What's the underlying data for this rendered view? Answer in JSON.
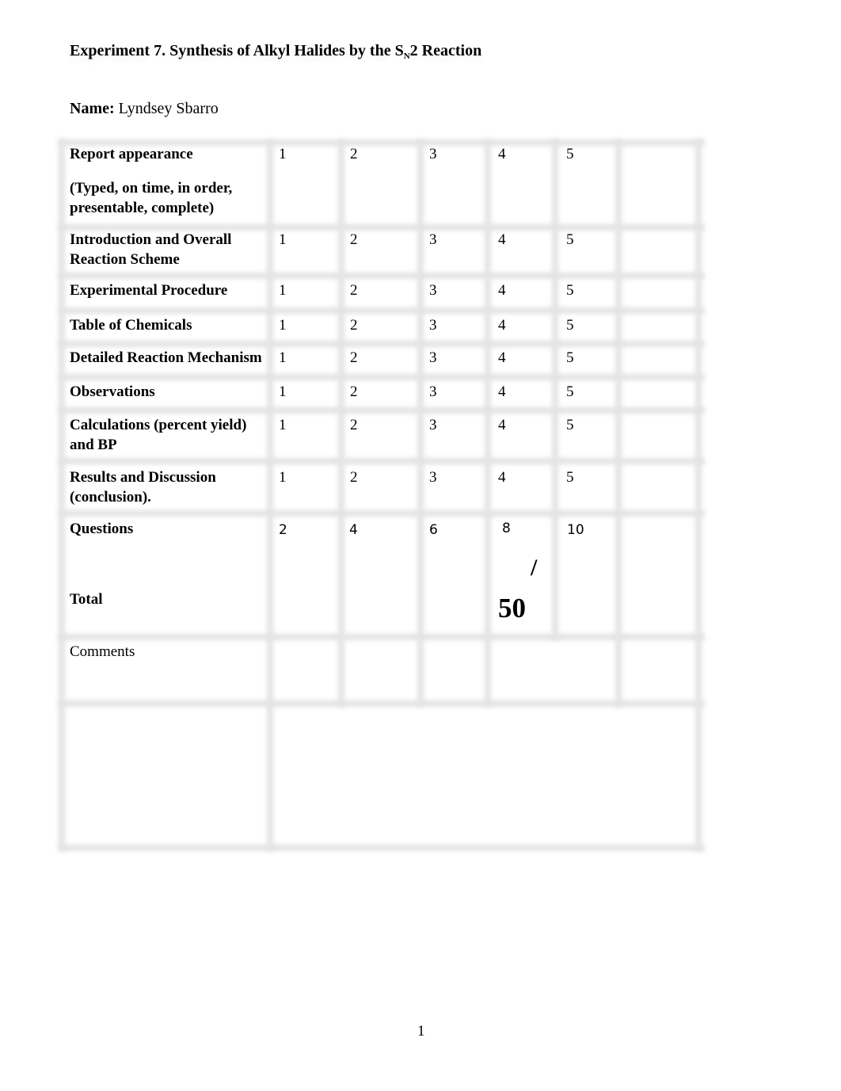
{
  "document": {
    "title_prefix": "Experiment 7.  Synthesis of Alkyl Halides by the S",
    "title_sub": "N",
    "title_suffix": "2 Reaction",
    "name_label": "Name:",
    "name_value": " Lyndsey Sbarro",
    "page_number": "1"
  },
  "rubric": {
    "rows": [
      {
        "label": "Report appearance",
        "scores": [
          "1",
          "2",
          "3",
          "4",
          "5"
        ]
      },
      {
        "label": "(Typed, on time, in order, presentable, complete)",
        "scores": []
      },
      {
        "label": "Introduction and Overall Reaction Scheme",
        "scores": [
          "1",
          "2",
          "3",
          "4",
          "5"
        ]
      },
      {
        "label": "Experimental Procedure",
        "scores": [
          "1",
          "2",
          "3",
          "4",
          "5"
        ]
      },
      {
        "label": "Table of Chemicals",
        "scores": [
          "1",
          "2",
          "3",
          "4",
          "5"
        ]
      },
      {
        "label": "Detailed Reaction Mechanism",
        "scores": [
          "1",
          "2",
          "3",
          "4",
          "5"
        ]
      },
      {
        "label": "Observations",
        "scores": [
          "1",
          "2",
          "3",
          "4",
          "5"
        ]
      },
      {
        "label": "Calculations (percent yield) and BP",
        "scores": [
          "1",
          "2",
          "3",
          "4",
          "5"
        ]
      },
      {
        "label": "Results and Discussion (conclusion).",
        "scores": [
          "1",
          "2",
          "3",
          "4",
          "5"
        ]
      },
      {
        "label": "Questions",
        "scores": [
          "2",
          "4",
          "6",
          "8",
          "10"
        ]
      }
    ],
    "total_label": "Total",
    "total_slash": "/",
    "total_max": "50",
    "comments_label": "Comments"
  }
}
